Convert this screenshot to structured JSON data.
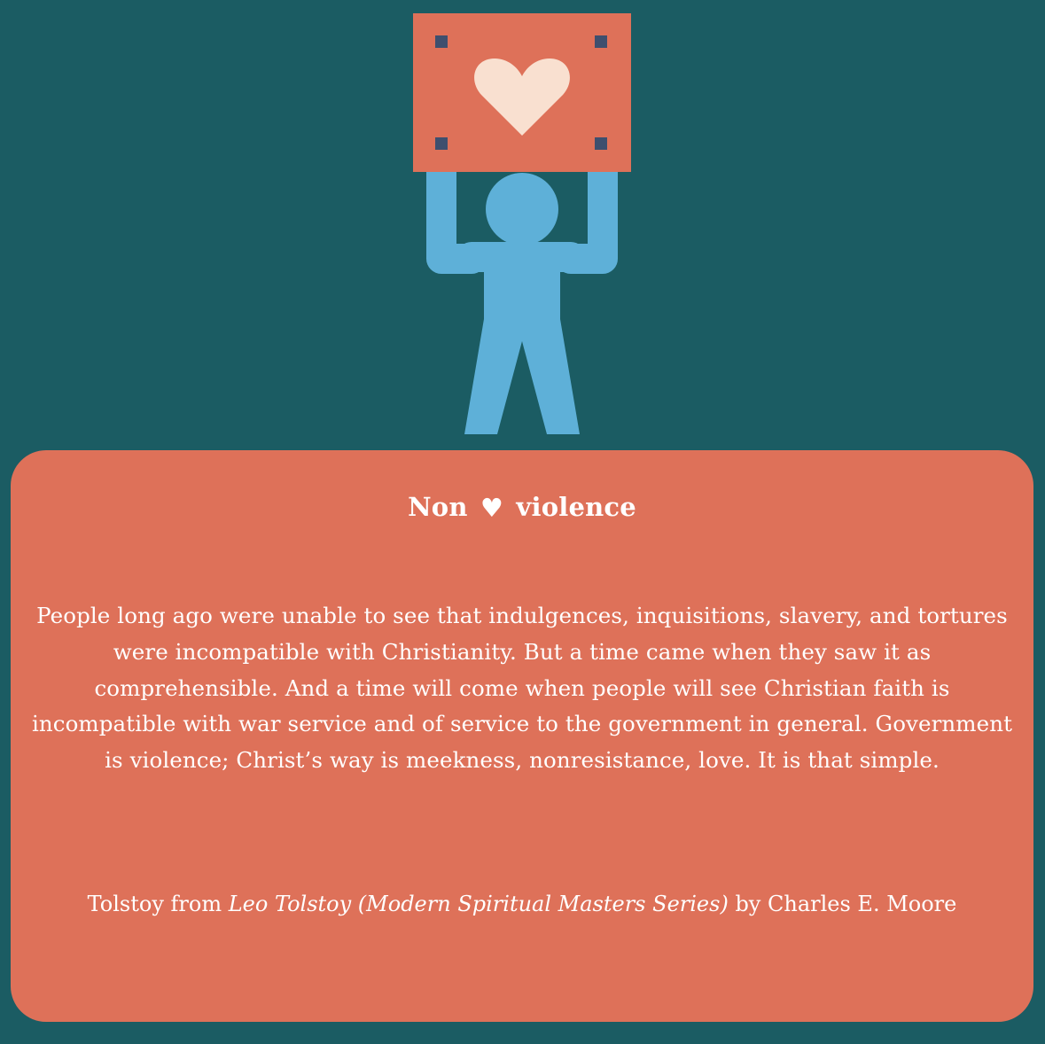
{
  "colors": {
    "background": "#1b5c63",
    "card": "#de7159",
    "sign": "#de7159",
    "sign_heart": "#f9e0d0",
    "sign_corners": "#3e4f6e",
    "person": "#5eb0d8",
    "text": "#ffffff"
  },
  "illustration": {
    "icons": [
      "sign-icon",
      "heart-icon",
      "person-icon"
    ]
  },
  "card": {
    "title_left": "Non",
    "title_heart": "♥",
    "title_right": "violence",
    "quote": "People long ago were unable to see that indulgences, inquisitions, slavery, and tortures were incompatible with Christianity. But a time came when they saw it as comprehensible. And a time will come when people will see Christian faith is incompatible with war service and of service to the government in general. Government is violence; Christ’s way is meekness, nonresistance, love. It is that simple.",
    "attribution_prefix": "Tolstoy from ",
    "attribution_book": "Leo Tolstoy (Modern Spiritual Masters Series)",
    "attribution_suffix": " by Charles E. Moore"
  }
}
